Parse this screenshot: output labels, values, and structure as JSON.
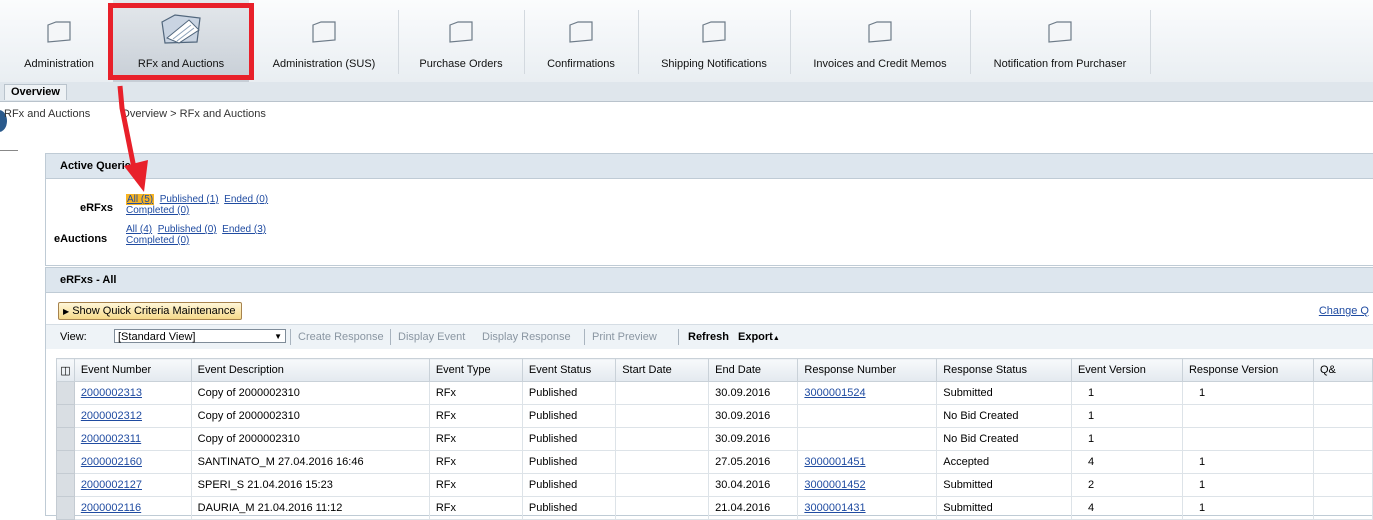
{
  "nav": {
    "tabs": [
      {
        "label": "Administration"
      },
      {
        "label": "RFx and Auctions"
      },
      {
        "label": "Administration (SUS)"
      },
      {
        "label": "Purchase Orders"
      },
      {
        "label": "Confirmations"
      },
      {
        "label": "Shipping Notifications"
      },
      {
        "label": "Invoices and Credit Memos"
      },
      {
        "label": "Notification from Purchaser"
      }
    ],
    "active_tab": "RFx and Auctions"
  },
  "subnav": {
    "tab": "Overview"
  },
  "breadcrumb": {
    "start": "RFx and Auctions",
    "path": "Overview  >  RFx and Auctions"
  },
  "active_queries": {
    "title": "Active Queries",
    "erfx": {
      "label": "eRFxs",
      "all": "All (5)",
      "published": "Published (1)",
      "ended": "Ended (0)",
      "completed": "Completed (0)"
    },
    "eauctions": {
      "label": "eAuctions",
      "all": "All (4)",
      "published": "Published (0)",
      "ended": "Ended (3)",
      "completed": "Completed (0)"
    }
  },
  "list": {
    "title": "eRFxs - All",
    "quick_criteria": "Show Quick Criteria Maintenance",
    "change_query": "Change Q",
    "toolbar": {
      "view_label": "View:",
      "view_value": "[Standard View]",
      "create_response": "Create Response",
      "display_event": "Display Event",
      "display_response": "Display Response",
      "print_preview": "Print Preview",
      "refresh": "Refresh",
      "export": "Export"
    },
    "columns": [
      "Event Number",
      "Event Description",
      "Event Type",
      "Event Status",
      "Start Date",
      "End Date",
      "Response Number",
      "Response Status",
      "Event Version",
      "Response Version",
      "Q&"
    ],
    "rows": [
      {
        "event_number": "2000002313",
        "description": "Copy of 2000002310",
        "type": "RFx",
        "status": "Published",
        "start": "",
        "end": "30.09.2016",
        "response_number": "3000001524",
        "response_status": "Submitted",
        "event_version": "1",
        "response_version": "1"
      },
      {
        "event_number": "2000002312",
        "description": "Copy of 2000002310",
        "type": "RFx",
        "status": "Published",
        "start": "",
        "end": "30.09.2016",
        "response_number": "",
        "response_status": "No Bid Created",
        "event_version": "1",
        "response_version": ""
      },
      {
        "event_number": "2000002311",
        "description": "Copy of 2000002310",
        "type": "RFx",
        "status": "Published",
        "start": "",
        "end": "30.09.2016",
        "response_number": "",
        "response_status": "No Bid Created",
        "event_version": "1",
        "response_version": ""
      },
      {
        "event_number": "2000002160",
        "description": "SANTINATO_M 27.04.2016 16:46",
        "type": "RFx",
        "status": "Published",
        "start": "",
        "end": "27.05.2016",
        "response_number": "3000001451",
        "response_status": "Accepted",
        "event_version": "4",
        "response_version": "1"
      },
      {
        "event_number": "2000002127",
        "description": "SPERI_S 21.04.2016 15:23",
        "type": "RFx",
        "status": "Published",
        "start": "",
        "end": "30.04.2016",
        "response_number": "3000001452",
        "response_status": "Submitted",
        "event_version": "2",
        "response_version": "1"
      },
      {
        "event_number": "2000002116",
        "description": "DAURIA_M 21.04.2016 11:12",
        "type": "RFx",
        "status": "Published",
        "start": "",
        "end": "21.04.2016",
        "response_number": "3000001431",
        "response_status": "Submitted",
        "event_version": "4",
        "response_version": "1"
      }
    ]
  },
  "colors": {
    "highlight": "#f7b423",
    "annotation_red": "#e8202a",
    "link": "#1f4ba1"
  }
}
